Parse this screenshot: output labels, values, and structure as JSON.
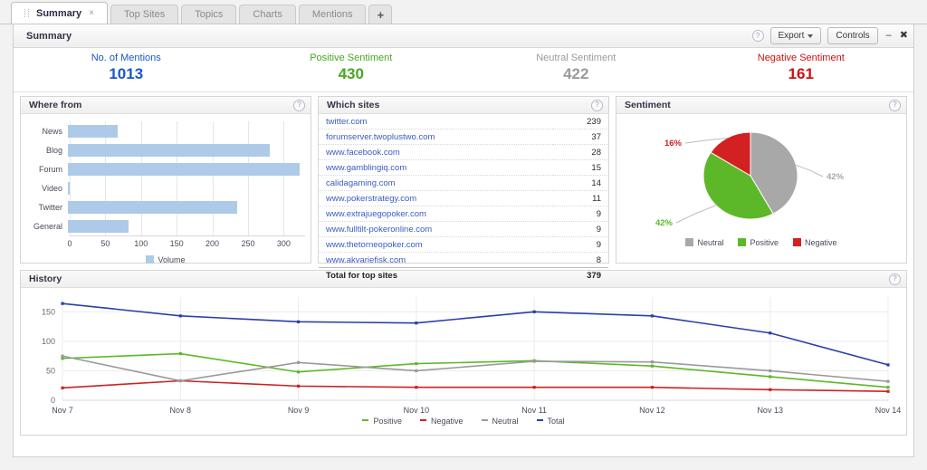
{
  "tabs": [
    {
      "label": "Summary",
      "active": true,
      "closable": true
    },
    {
      "label": "Top Sites",
      "active": false
    },
    {
      "label": "Topics",
      "active": false
    },
    {
      "label": "Charts",
      "active": false
    },
    {
      "label": "Mentions",
      "active": false
    }
  ],
  "tab_add_label": "+",
  "tab_close_glyph": "×",
  "window": {
    "title": "Summary",
    "help_glyph": "?",
    "export_label": "Export",
    "controls_label": "Controls",
    "minimize_glyph": "–",
    "close_glyph": "✖"
  },
  "kpis": [
    {
      "label": "No. of Mentions",
      "value": "1013",
      "color": "#1a57c8"
    },
    {
      "label": "Positive Sentiment",
      "value": "430",
      "color": "#49a621"
    },
    {
      "label": "Neutral Sentiment",
      "value": "422",
      "color": "#9a9a9a"
    },
    {
      "label": "Negative Sentiment",
      "value": "161",
      "color": "#cc1111"
    }
  ],
  "panels": {
    "where_from": {
      "title": "Where from",
      "help_glyph": "?"
    },
    "which_sites": {
      "title": "Which sites",
      "help_glyph": "?"
    },
    "sentiment": {
      "title": "Sentiment",
      "help_glyph": "?"
    },
    "history": {
      "title": "History",
      "help_glyph": "?"
    }
  },
  "which_sites": {
    "rows": [
      {
        "name": "twitter.com",
        "count": "239"
      },
      {
        "name": "forumserver.twoplustwo.com",
        "count": "37"
      },
      {
        "name": "www.facebook.com",
        "count": "28"
      },
      {
        "name": "www.gamblingiq.com",
        "count": "15"
      },
      {
        "name": "calidagaming.com",
        "count": "14"
      },
      {
        "name": "www.pokerstrategy.com",
        "count": "11"
      },
      {
        "name": "www.extrajuegopoker.com",
        "count": "9"
      },
      {
        "name": "www.fulltilt-pokeronline.com",
        "count": "9"
      },
      {
        "name": "www.thetorneopoker.com",
        "count": "9"
      },
      {
        "name": "www.akvariefisk.com",
        "count": "8"
      }
    ],
    "total_label": "Total for top sites",
    "total_count": "379"
  },
  "chart_data": [
    {
      "id": "where_from",
      "type": "bar",
      "orientation": "horizontal",
      "title": "Where from",
      "categories": [
        "News",
        "Blog",
        "Forum",
        "Video",
        "Twitter",
        "General"
      ],
      "values": [
        70,
        283,
        325,
        2,
        237,
        85
      ],
      "series": [
        {
          "name": "Volume",
          "values": [
            70,
            283,
            325,
            2,
            237,
            85
          ]
        }
      ],
      "xlabel": "",
      "ylabel": "",
      "xlim": [
        0,
        330
      ],
      "xticks": [
        0,
        50,
        100,
        150,
        200,
        250,
        300
      ],
      "legend": [
        {
          "label": "Volume",
          "color": "#adcbe8"
        }
      ],
      "legend_position": "bottom",
      "grid": true,
      "bar_color": "#adcbe8"
    },
    {
      "id": "sentiment",
      "type": "pie",
      "title": "Sentiment",
      "labels": [
        "Neutral",
        "Positive",
        "Negative"
      ],
      "values": [
        42,
        42,
        16
      ],
      "value_labels": [
        "42%",
        "42%",
        "16%"
      ],
      "colors": [
        "#a8a8a8",
        "#5cb829",
        "#d32020"
      ],
      "legend": [
        {
          "label": "Neutral",
          "color": "#a8a8a8"
        },
        {
          "label": "Positive",
          "color": "#5cb829"
        },
        {
          "label": "Negative",
          "color": "#d32020"
        }
      ],
      "legend_position": "bottom"
    },
    {
      "id": "history",
      "type": "line",
      "title": "History",
      "x": [
        "Nov 7",
        "Nov 8",
        "Nov 9",
        "Nov 10",
        "Nov 11",
        "Nov 12",
        "Nov 13",
        "Nov 14"
      ],
      "series": [
        {
          "name": "Positive",
          "color": "#5cb829",
          "values": [
            71,
            79,
            48,
            62,
            67,
            58,
            40,
            22
          ]
        },
        {
          "name": "Negative",
          "color": "#cc2222",
          "values": [
            21,
            33,
            24,
            22,
            22,
            22,
            18,
            15
          ]
        },
        {
          "name": "Neutral",
          "color": "#9a9a9a",
          "values": [
            75,
            33,
            64,
            50,
            66,
            65,
            50,
            32
          ]
        },
        {
          "name": "Total",
          "color": "#2a3fa8",
          "values": [
            164,
            143,
            133,
            131,
            150,
            143,
            114,
            60
          ]
        }
      ],
      "xlabel": "",
      "ylabel": "",
      "ylim": [
        0,
        175
      ],
      "yticks": [
        0,
        50,
        100,
        150
      ],
      "grid": true,
      "legend_position": "bottom",
      "legend": [
        {
          "label": "Positive",
          "color": "#5cb829"
        },
        {
          "label": "Negative",
          "color": "#cc2222"
        },
        {
          "label": "Neutral",
          "color": "#9a9a9a"
        },
        {
          "label": "Total",
          "color": "#2a3fa8"
        }
      ]
    }
  ]
}
